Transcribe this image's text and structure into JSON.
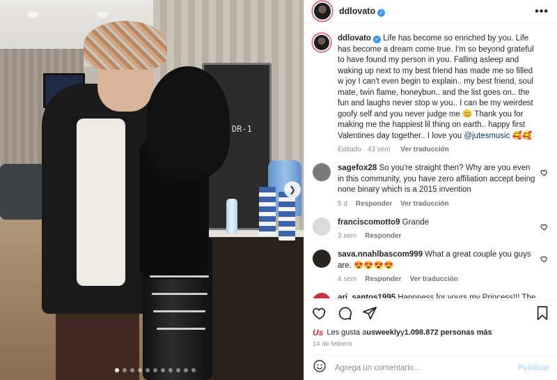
{
  "header": {
    "username": "ddlovato",
    "more_label": "•••"
  },
  "caption": {
    "username": "ddlovato",
    "text": "Life has become so enriched by you. Life has become a dream come true. I'm so beyond grateful to have found my person in you. Falling asleep and waking up next to my best friend has made me so filled w joy I can't even begin to explain.. my best friend, soul mate, twin flame, honeybun.. and the list goes on.. the fun and laughs never stop w you.. I can be my weirdest goofy self and you never judge me 😊 Thank you for making me the happiest lil thing on earth.. happy first Valentines day together.. I love you ",
    "mention": "@jutesmusic",
    "emoji_tail": " 🥰🥰",
    "edited": "Editado · 43 sem",
    "translate": "Ver traducción"
  },
  "comments": [
    {
      "username": "sagefox28",
      "text": "So you're straight then? Why are you even in this community, you have zero affiliation accept being none binary which is a 2015 invention",
      "time": "5 d",
      "reply": "Responder",
      "translate": "Ver traducción",
      "avatar_color": "#7a7a7a"
    },
    {
      "username": "franciscomotto9",
      "text": "Grande",
      "time": "3 sem",
      "reply": "Responder",
      "translate": "",
      "avatar_color": "#dbdbdb"
    },
    {
      "username": "sava.nnahlbascom999",
      "text": "What a great couple you guys are. 😍😍😍😍",
      "time": "4 sem",
      "reply": "Responder",
      "translate": "Ver traducción",
      "avatar_color": "#2a2420"
    },
    {
      "username": "ari_santos1995",
      "text": "Happness for yours my Princess!!! The Brazil love you !💚💚💚💚💛",
      "time": "",
      "reply": "",
      "translate": "",
      "avatar_color": "#c8323c"
    }
  ],
  "likes": {
    "prefix": "Les gusta a ",
    "user": "usweekly",
    "middle": " y ",
    "count": "1.098.872 personas más",
    "badge": "Us"
  },
  "date": "14 de febrero",
  "compose": {
    "placeholder": "Agrega un comentario...",
    "post_label": "Publicar"
  },
  "photo": {
    "case_label": "DR-1",
    "slide_count": 11,
    "active_slide": 0
  },
  "colors": {
    "accent_blue": "#3897f0",
    "post_disabled": "#b2dffc",
    "story_ring": "#e4405f",
    "usweekly_red": "#e8232a"
  },
  "icons": {
    "like": "heart-icon",
    "comment": "comment-icon",
    "share": "send-icon",
    "save": "bookmark-icon",
    "emoji": "smiley-icon",
    "more": "more-dots-icon",
    "next": "chevron-right-icon",
    "verified": "verified-badge-icon"
  }
}
